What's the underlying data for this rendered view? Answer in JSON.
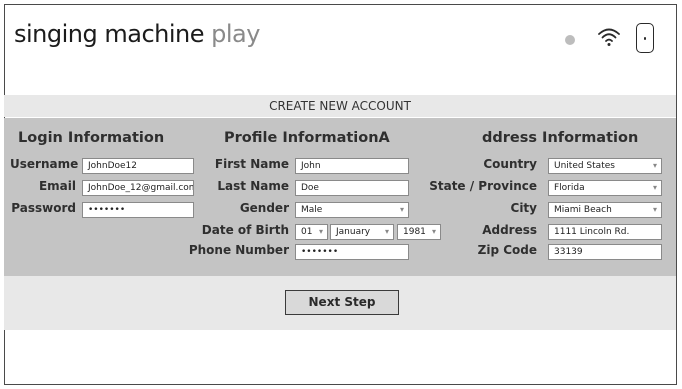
{
  "header": {
    "brand_main": "singing machine",
    "brand_accent": "play"
  },
  "page_title": "CREATE NEW ACCOUNT",
  "login": {
    "title": "Login Information",
    "username_label": "Username",
    "username_value": "JohnDoe12",
    "email_label": "Email",
    "email_value": "JohnDoe_12@gmail.com",
    "password_label": "Password",
    "password_value": "•••••••"
  },
  "profile": {
    "title": "Profile InformationA",
    "first_name_label": "First Name",
    "first_name_value": "John",
    "last_name_label": "Last Name",
    "last_name_value": "Doe",
    "gender_label": "Gender",
    "gender_value": "Male",
    "dob_label": "Date of Birth",
    "dob_day": "01",
    "dob_month": "January",
    "dob_year": "1981",
    "phone_label": "Phone Number",
    "phone_value": "•••••••"
  },
  "address": {
    "title": "ddress Information",
    "country_label": "Country",
    "country_value": "United States",
    "state_label": "State / Province",
    "state_value": "Florida",
    "city_label": "City",
    "city_value": "Miami Beach",
    "address_label": "Address",
    "address_value": "1111 Lincoln Rd.",
    "zip_label": "Zip Code",
    "zip_value": "33139"
  },
  "next_label": "Next Step",
  "icons": {
    "status": "status-dot-icon",
    "wifi": "wifi-icon",
    "device": "phone-icon"
  }
}
